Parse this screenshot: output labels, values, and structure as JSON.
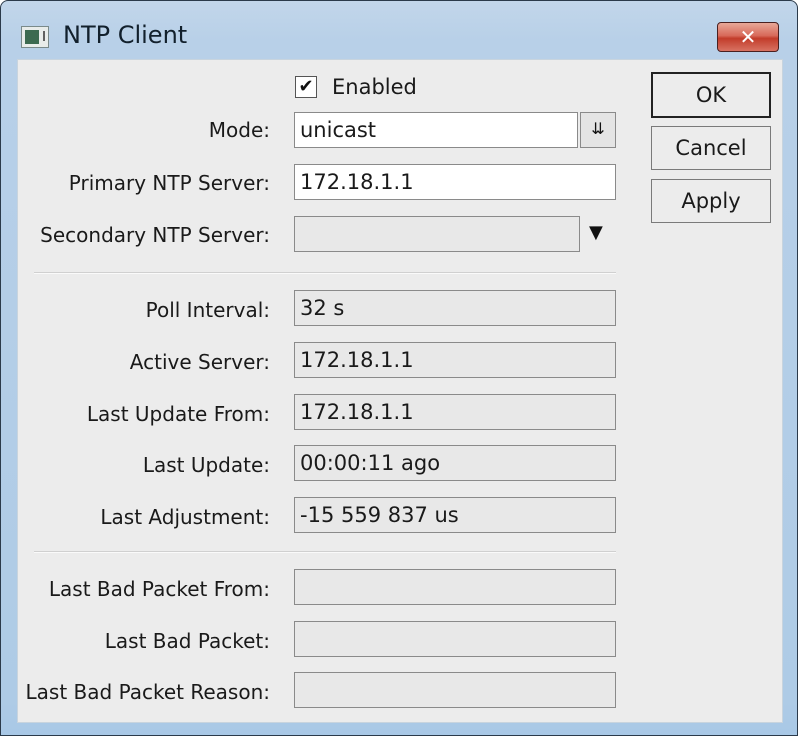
{
  "window": {
    "title": "NTP Client",
    "close_glyph": "✕"
  },
  "form": {
    "enabled": {
      "label": "Enabled",
      "checked": true,
      "glyph": "✔"
    },
    "mode": {
      "label": "Mode:",
      "value": "unicast",
      "dropdown_glyph": "⇊"
    },
    "primary_server": {
      "label": "Primary NTP Server:",
      "value": "172.18.1.1"
    },
    "secondary_server": {
      "label": "Secondary NTP Server:",
      "value": "",
      "dropdown_glyph": "▼"
    },
    "poll_interval": {
      "label": "Poll Interval:",
      "value": "32 s"
    },
    "active_server": {
      "label": "Active Server:",
      "value": "172.18.1.1"
    },
    "last_update_from": {
      "label": "Last Update From:",
      "value": "172.18.1.1"
    },
    "last_update": {
      "label": "Last Update:",
      "value": "00:00:11 ago"
    },
    "last_adjustment": {
      "label": "Last Adjustment:",
      "value": "-15 559 837 us"
    },
    "last_bad_packet_from": {
      "label": "Last Bad Packet From:",
      "value": ""
    },
    "last_bad_packet": {
      "label": "Last Bad Packet:",
      "value": ""
    },
    "last_bad_packet_reason": {
      "label": "Last Bad Packet Reason:",
      "value": ""
    }
  },
  "buttons": {
    "ok": "OK",
    "cancel": "Cancel",
    "apply": "Apply"
  }
}
